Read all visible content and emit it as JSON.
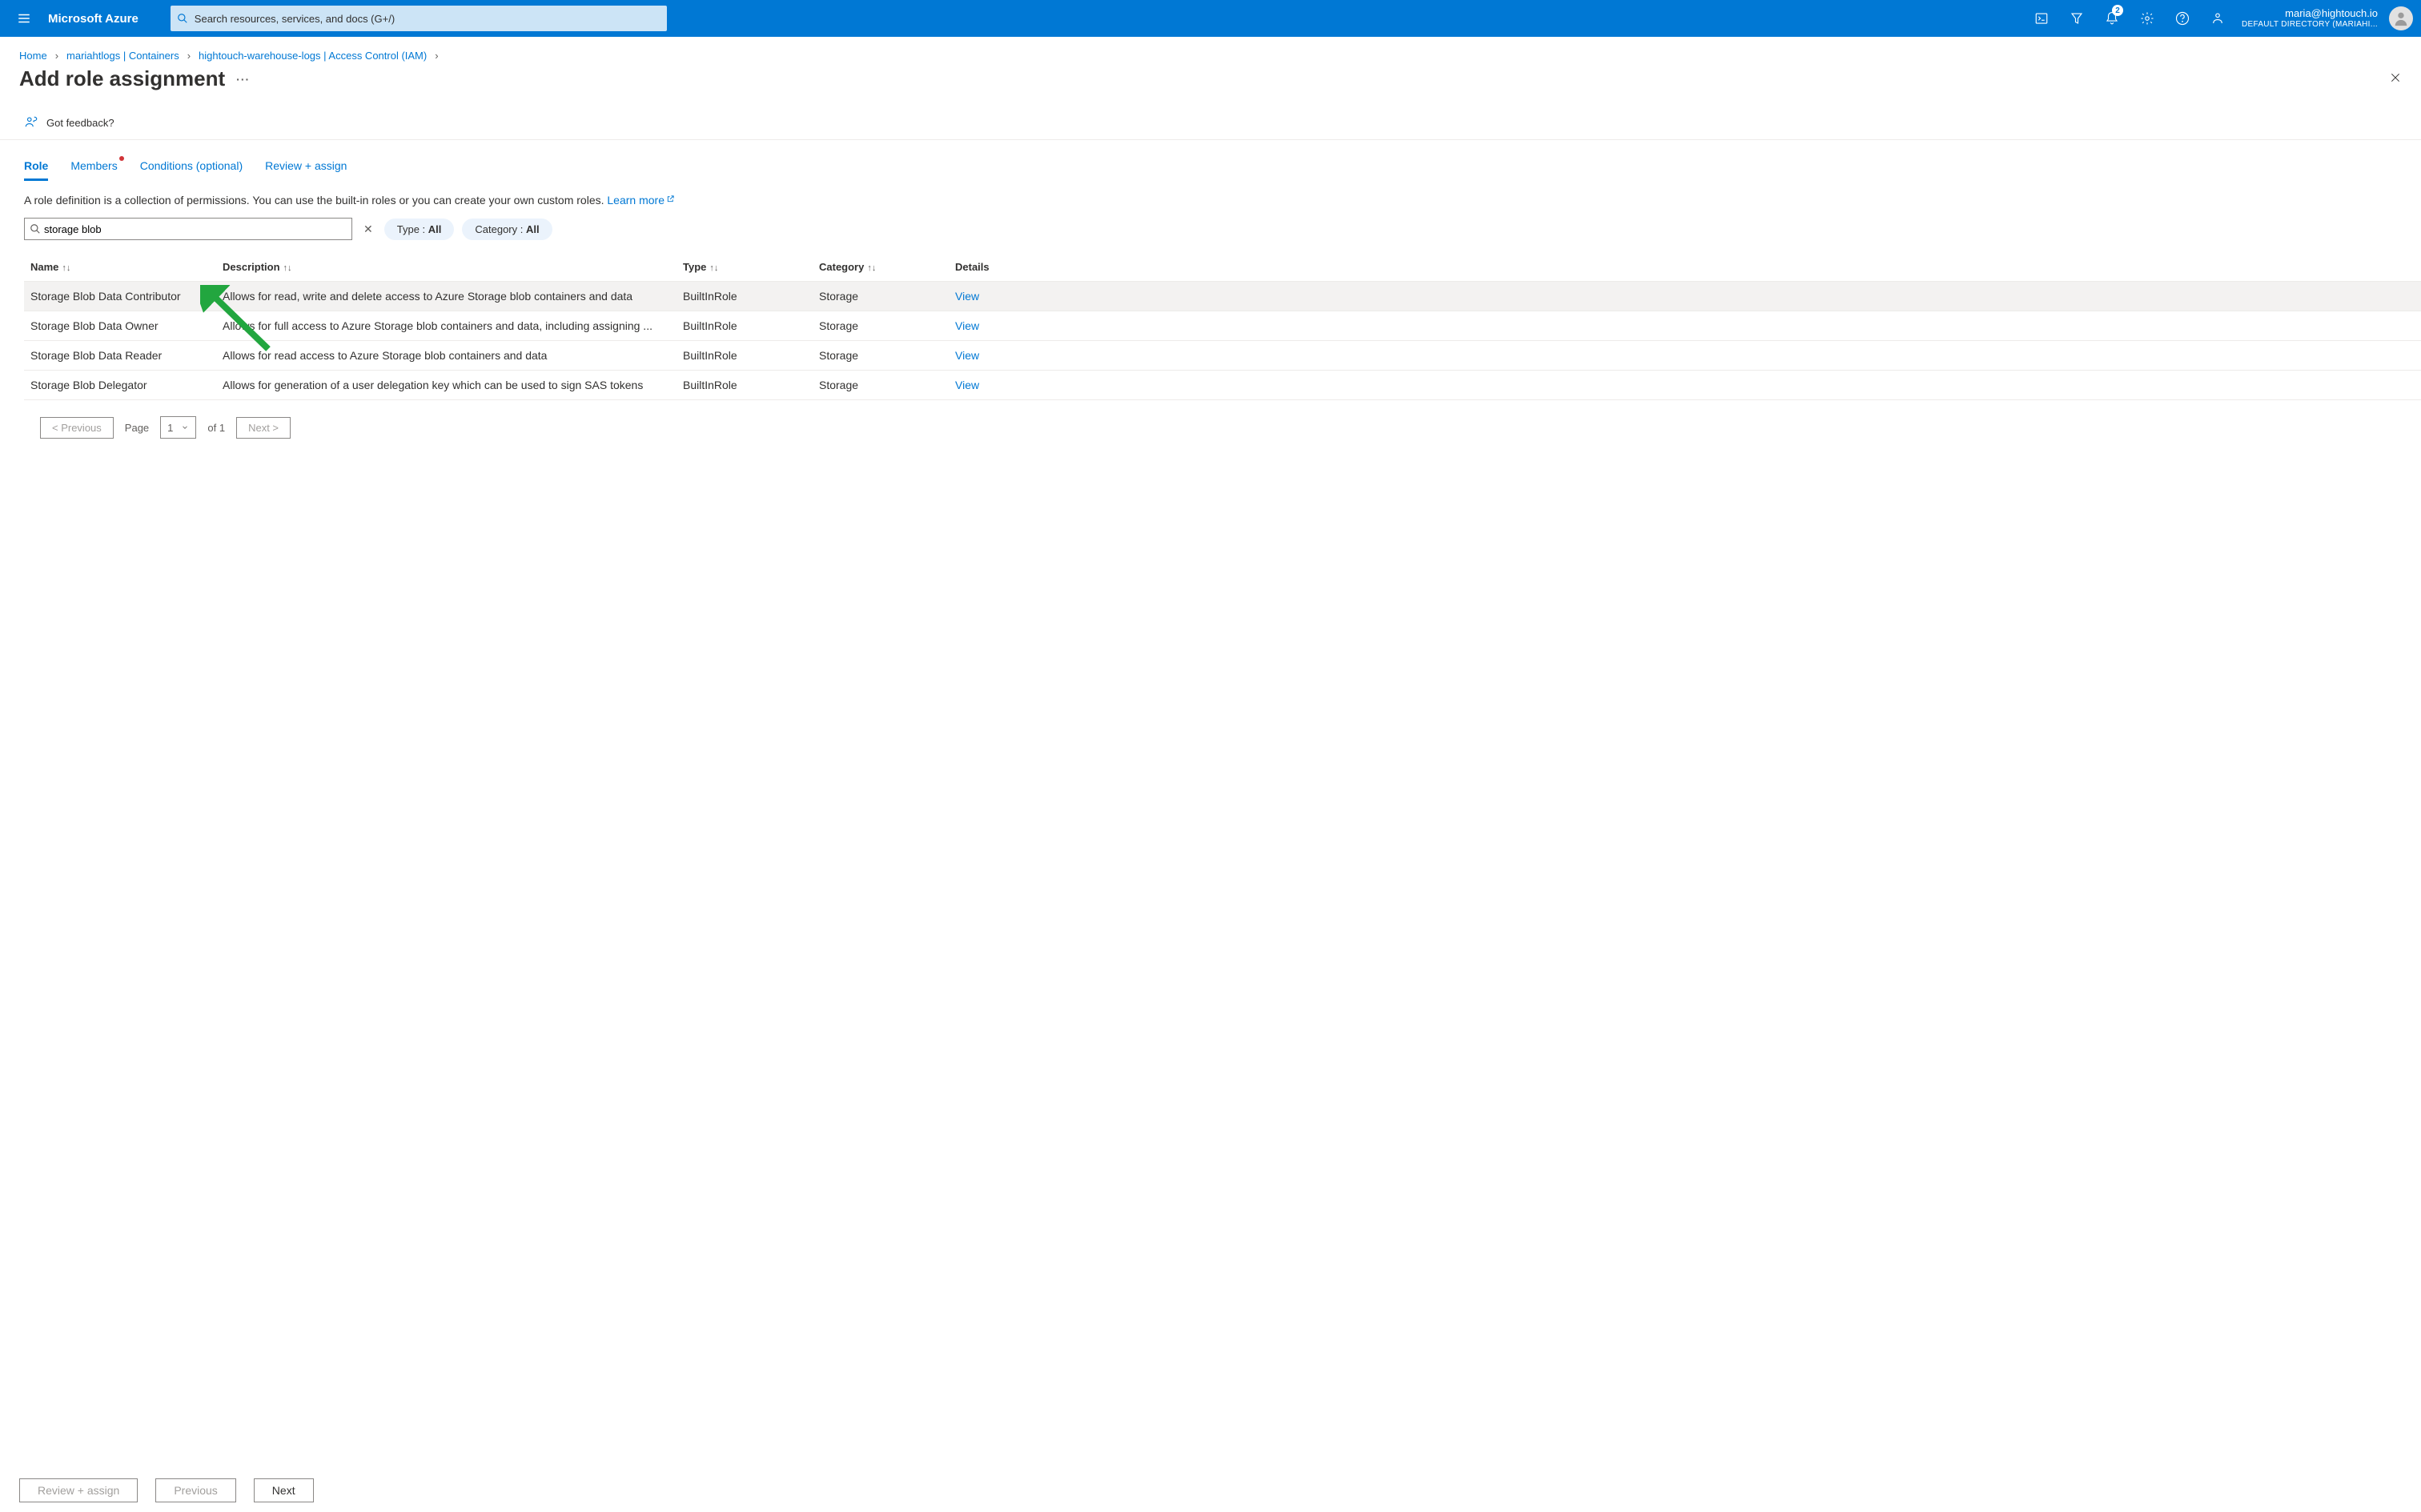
{
  "header": {
    "brand": "Microsoft Azure",
    "search_placeholder": "Search resources, services, and docs (G+/)",
    "notification_count": "2",
    "user_email": "maria@hightouch.io",
    "user_dir": "DEFAULT DIRECTORY (MARIAHI..."
  },
  "breadcrumb": [
    "Home",
    "mariahtlogs | Containers",
    "hightouch-warehouse-logs | Access Control (IAM)"
  ],
  "page_title": "Add role assignment",
  "feedback_label": "Got feedback?",
  "tabs": {
    "role": "Role",
    "members": "Members",
    "conditions": "Conditions (optional)",
    "review": "Review + assign"
  },
  "description": "A role definition is a collection of permissions. You can use the built-in roles or you can create your own custom roles.",
  "learn_more": "Learn more",
  "filters": {
    "search_value": "storage blob",
    "type_label": "Type : ",
    "type_value": "All",
    "category_label": "Category : ",
    "category_value": "All"
  },
  "table": {
    "headers": {
      "name": "Name",
      "description": "Description",
      "type": "Type",
      "category": "Category",
      "details": "Details"
    },
    "rows": [
      {
        "name": "Storage Blob Data Contributor",
        "description": "Allows for read, write and delete access to Azure Storage blob containers and data",
        "type": "BuiltInRole",
        "category": "Storage",
        "details": "View",
        "selected": true
      },
      {
        "name": "Storage Blob Data Owner",
        "description": "Allows for full access to Azure Storage blob containers and data, including assigning ...",
        "type": "BuiltInRole",
        "category": "Storage",
        "details": "View",
        "selected": false
      },
      {
        "name": "Storage Blob Data Reader",
        "description": "Allows for read access to Azure Storage blob containers and data",
        "type": "BuiltInRole",
        "category": "Storage",
        "details": "View",
        "selected": false
      },
      {
        "name": "Storage Blob Delegator",
        "description": "Allows for generation of a user delegation key which can be used to sign SAS tokens",
        "type": "BuiltInRole",
        "category": "Storage",
        "details": "View",
        "selected": false
      }
    ]
  },
  "pagination": {
    "prev": "< Previous",
    "page_label": "Page",
    "current": "1",
    "of_label": "of 1",
    "next": "Next >"
  },
  "footer": {
    "review": "Review + assign",
    "previous": "Previous",
    "next": "Next"
  }
}
